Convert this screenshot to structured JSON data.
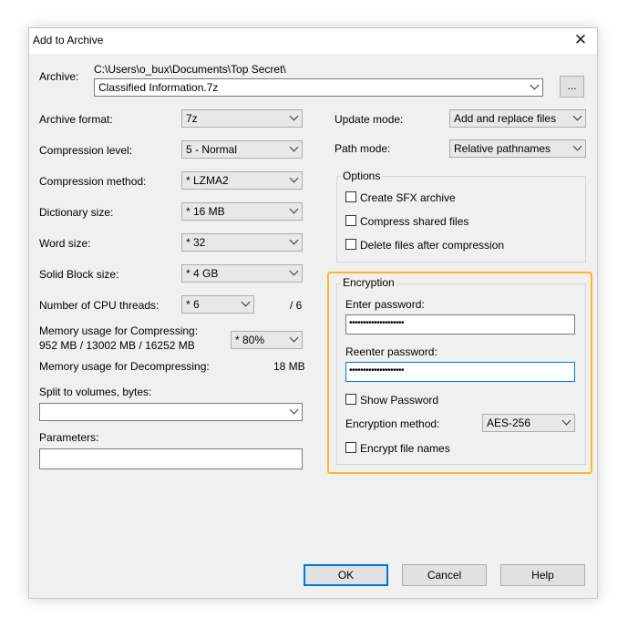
{
  "window": {
    "title": "Add to Archive",
    "close_label": "✕"
  },
  "archive": {
    "label": "Archive:",
    "path": "C:\\Users\\o_bux\\Documents\\Top Secret\\",
    "filename": "Classified Information.7z",
    "browse_label": "..."
  },
  "left": {
    "format": {
      "label": "Archive format:",
      "value": "7z"
    },
    "level": {
      "label": "Compression level:",
      "value": "5 - Normal"
    },
    "method": {
      "label": "Compression method:",
      "value": "* LZMA2"
    },
    "dict": {
      "label": "Dictionary size:",
      "value": "* 16 MB"
    },
    "word": {
      "label": "Word size:",
      "value": "* 32"
    },
    "solid": {
      "label": "Solid Block size:",
      "value": "* 4 GB"
    },
    "cpu": {
      "label": "Number of CPU threads:",
      "value": "* 6",
      "max": "/ 6"
    },
    "mem_comp": {
      "label": "Memory usage for Compressing:",
      "detail": "952 MB / 13002 MB / 16252 MB",
      "value": "* 80%"
    },
    "mem_decomp": {
      "label": "Memory usage for Decompressing:",
      "value": "18 MB"
    },
    "split": {
      "label": "Split to volumes, bytes:",
      "value": ""
    },
    "params": {
      "label": "Parameters:",
      "value": ""
    }
  },
  "right": {
    "update": {
      "label": "Update mode:",
      "value": "Add and replace files"
    },
    "path": {
      "label": "Path mode:",
      "value": "Relative pathnames"
    },
    "options": {
      "title": "Options",
      "sfx": "Create SFX archive",
      "shared": "Compress shared files",
      "delete": "Delete files after compression"
    },
    "encryption": {
      "title": "Encryption",
      "enter_label": "Enter password:",
      "enter_value": "••••••••••••••••••••",
      "reenter_label": "Reenter password:",
      "reenter_value": "••••••••••••••••••••",
      "show_label": "Show Password",
      "method_label": "Encryption method:",
      "method_value": "AES-256",
      "names_label": "Encrypt file names"
    }
  },
  "buttons": {
    "ok": "OK",
    "cancel": "Cancel",
    "help": "Help"
  },
  "colors": {
    "highlight": "#f5b82e",
    "focus": "#0078d7"
  }
}
